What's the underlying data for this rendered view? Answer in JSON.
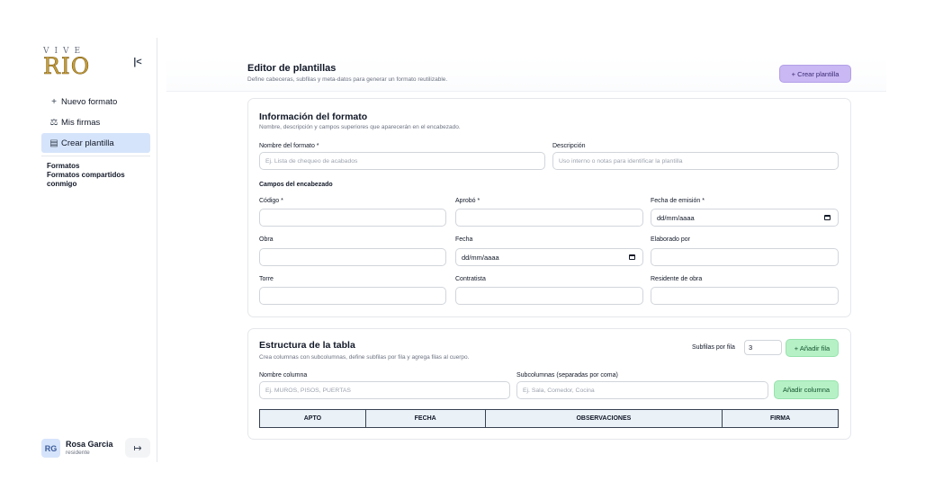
{
  "sidebar": {
    "logo_top": "VIVE",
    "logo_main": "RIO",
    "collapse_icon": "K-collapse-icon",
    "nav": [
      {
        "icon": "+",
        "label": "Nuevo formato"
      },
      {
        "icon": "⚖",
        "label": "Mis firmas"
      },
      {
        "icon": "▤",
        "label": "Crear plantilla"
      }
    ],
    "sections": [
      "Formatos",
      "Formatos compartidos conmigo"
    ],
    "user": {
      "initials": "RG",
      "name": "Rosa Garcia",
      "role": "residente"
    }
  },
  "header": {
    "title": "Editor de plantillas",
    "subtitle": "Define cabeceras, subfilas y meta-datos para generar un formato reutilizable.",
    "create_button": "+ Crear plantilla"
  },
  "info": {
    "title": "Información del formato",
    "subtitle": "Nombre, descripción y campos superiores que aparecerán en el encabezado.",
    "name_label": "Nombre del formato *",
    "name_placeholder": "Ej. Lista de chequeo de acabados",
    "desc_label": "Descripción",
    "desc_placeholder": "Uso interno o notas para identificar la plantilla",
    "header_fields_title": "Campos del encabezado",
    "fields": {
      "codigo": "Código *",
      "aprobo": "Aprobó *",
      "fecha_emision": "Fecha de emisión *",
      "obra": "Obra",
      "fecha": "Fecha",
      "elaborado": "Elaborado por",
      "torre": "Torre",
      "contratista": "Contratista",
      "residente": "Residente de obra"
    },
    "date_placeholder": "dd/mm/aaaa"
  },
  "structure": {
    "title": "Estructura de la tabla",
    "subtitle": "Crea columnas con subcolumnas, define subfilas por fila y agrega filas al cuerpo.",
    "subrows_label": "Subfilas por fila",
    "subrows_value": "3",
    "add_row_button": "+ Añadir fila",
    "column_label": "Nombre columna",
    "column_placeholder": "Ej. MUROS, PISOS, PUERTAS",
    "subcolumns_label": "Subcolumnas (separadas por coma)",
    "subcolumns_placeholder": "Ej. Sala, Comedor, Cocina",
    "add_column_button": "Añadir columna",
    "columns": [
      "APTO",
      "FECHA",
      "OBSERVACIONES",
      "FIRMA"
    ]
  },
  "colors": {
    "accent_purple": "#c9b8f3",
    "accent_green": "#b6f1c6",
    "active_nav": "#d6e4fb",
    "table_header": "#eaf1f7"
  }
}
